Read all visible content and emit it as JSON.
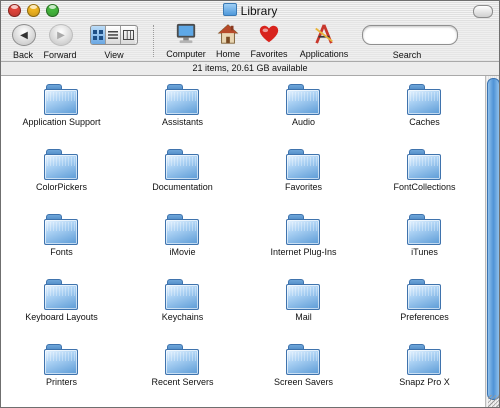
{
  "window": {
    "title": "Library"
  },
  "toolbar": {
    "back_label": "Back",
    "forward_label": "Forward",
    "view_label": "View",
    "computer_label": "Computer",
    "home_label": "Home",
    "favorites_label": "Favorites",
    "applications_label": "Applications",
    "search_label": "Search",
    "search_value": ""
  },
  "status": {
    "text": "21 items, 20.61 GB available"
  },
  "items": [
    {
      "label": "Application Support"
    },
    {
      "label": "Assistants"
    },
    {
      "label": "Audio"
    },
    {
      "label": "Caches"
    },
    {
      "label": "ColorPickers"
    },
    {
      "label": "Documentation"
    },
    {
      "label": "Favorites"
    },
    {
      "label": "FontCollections"
    },
    {
      "label": "Fonts"
    },
    {
      "label": "iMovie"
    },
    {
      "label": "Internet Plug-Ins"
    },
    {
      "label": "iTunes"
    },
    {
      "label": "Keyboard Layouts"
    },
    {
      "label": "Keychains"
    },
    {
      "label": "Mail"
    },
    {
      "label": "Preferences"
    },
    {
      "label": "Printers"
    },
    {
      "label": "Recent Servers"
    },
    {
      "label": "Screen Savers"
    },
    {
      "label": "Snapz Pro X"
    }
  ],
  "colors": {
    "aqua_blue": "#4f93d6",
    "close_red": "#e0443b",
    "minimize_yellow": "#f1b521",
    "zoom_green": "#45b83e"
  }
}
